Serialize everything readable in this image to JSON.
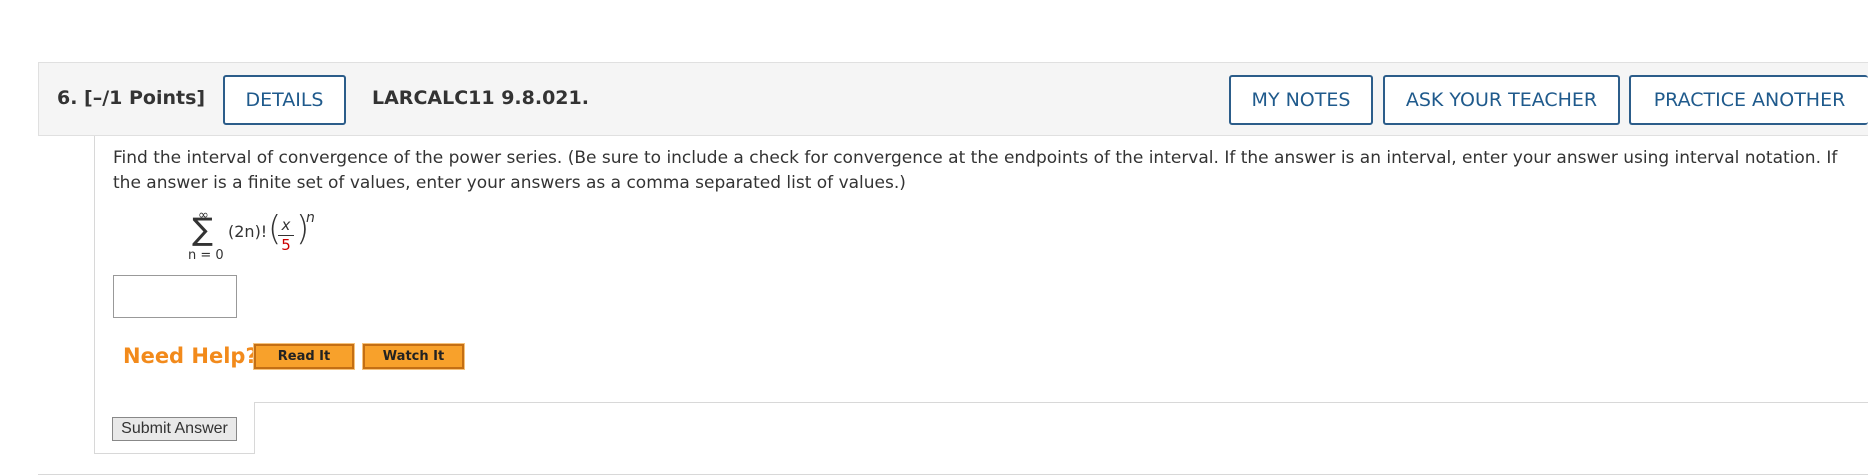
{
  "question": {
    "number_points": "6.  [–/1 Points]",
    "code": "LARCALC11 9.8.021."
  },
  "buttons": {
    "details": "DETAILS",
    "my_notes": "MY NOTES",
    "ask_teacher": "ASK YOUR TEACHER",
    "practice_another": "PRACTICE ANOTHER"
  },
  "prompt": "Find the interval of convergence of the power series. (Be sure to include a check for convergence at the endpoints of the interval. If the answer is an interval, enter your answer using interval notation. If the answer is a finite set of values, enter your answers as a comma separated list of values.)",
  "series": {
    "upper": "∞",
    "lower": "n = 0",
    "term": "(2n)!",
    "numerator": "x",
    "denominator": "5",
    "exponent": "n"
  },
  "answer": {
    "value": ""
  },
  "help": {
    "label": "Need Help?",
    "read_it": "Read It",
    "watch_it": "Watch It"
  },
  "submit": "Submit Answer",
  "colors": {
    "button_border": "#2c5d8a",
    "help_orange": "#f28a1b",
    "help_button": "#f8a12b",
    "denominator_red": "#cc0000"
  }
}
